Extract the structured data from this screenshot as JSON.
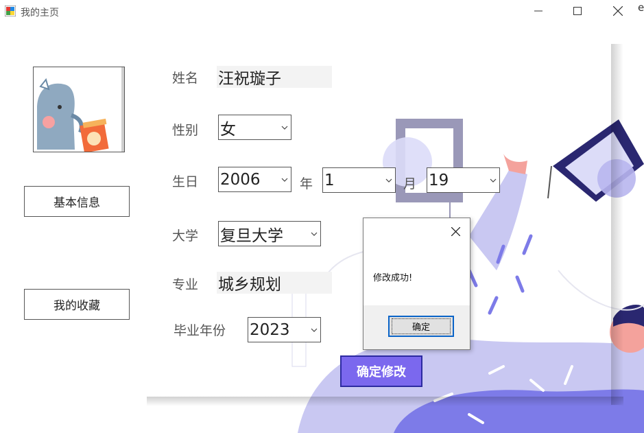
{
  "window": {
    "title": "我的主页",
    "edge_char": "e"
  },
  "nav": {
    "basic_info": "基本信息",
    "favorites": "我的收藏"
  },
  "form": {
    "name_label": "姓名",
    "name_value": "汪祝璇子",
    "gender_label": "性别",
    "gender_value": "女",
    "birthday_label": "生日",
    "birth_year": "2006",
    "year_unit": "年",
    "birth_month": "1",
    "month_unit": "月",
    "birth_day": "19",
    "university_label": "大学",
    "university_value": "复旦大学",
    "major_label": "专业",
    "major_value": "城乡规划",
    "grad_year_label": "毕业年份",
    "grad_year_value": "2023",
    "confirm_label": "确定修改"
  },
  "dialog": {
    "message": "修改成功!",
    "ok_label": "确定"
  },
  "colors": {
    "accent": "#7b68ee",
    "accent_border": "#2c2aa0",
    "illustration_primary": "#8f8bd8",
    "illustration_light": "#c9c8f2"
  }
}
